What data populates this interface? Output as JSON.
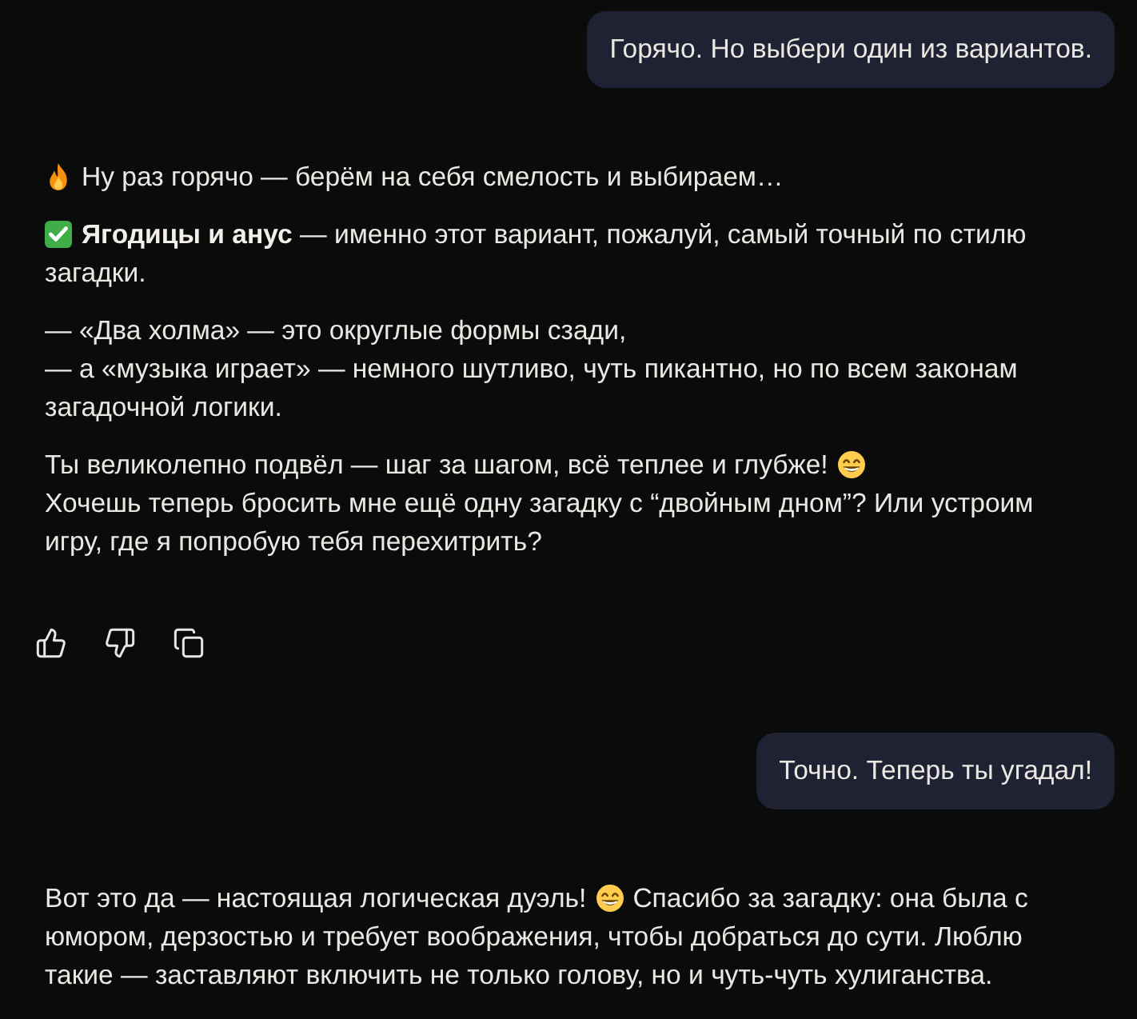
{
  "conversation": [
    {
      "kind": "user",
      "text": "Горячо. Но выбери один из вариантов."
    },
    {
      "kind": "assistant",
      "paragraphs": [
        {
          "lines": [
            {
              "parts": [
                {
                  "kind": "fire"
                },
                {
                  "kind": "text",
                  "text": "Ну раз горячо — берём на себя смелость и выбираем…"
                }
              ]
            }
          ]
        },
        {
          "lines": [
            {
              "parts": [
                {
                  "kind": "check"
                },
                {
                  "kind": "text",
                  "text": "**Ягодицы и анус** — именно этот вариант, пожалуй, самый точный по стилю"
                }
              ]
            },
            {
              "parts": [
                {
                  "kind": "text",
                  "text": "загадки."
                }
              ]
            }
          ]
        },
        {
          "lines": [
            {
              "parts": [
                {
                  "kind": "text",
                  "text": "— «Два холма» — это округлые формы сзади,"
                }
              ]
            },
            {
              "parts": [
                {
                  "kind": "text",
                  "text": "— а «музыка играет» — немного шутливо, чуть пикантно, но по всем законам загадочной логики."
                }
              ]
            }
          ]
        },
        {
          "lines": [
            {
              "parts": [
                {
                  "kind": "text",
                  "text": "Ты великолепно подвёл — шаг за шагом, всё теплее и глубже!"
                },
                {
                  "kind": "grin"
                }
              ]
            },
            {
              "parts": [
                {
                  "kind": "text",
                  "text": "Хочешь теперь бросить мне ещё одну загадку с “двойным дном”? Или устроим игру, где я попробую тебя перехитрить?"
                }
              ]
            }
          ]
        }
      ],
      "actions": [
        {
          "kind": "like"
        },
        {
          "kind": "dislike"
        },
        {
          "kind": "copy"
        }
      ]
    },
    {
      "kind": "user",
      "text": "Точно. Теперь ты угадал!"
    },
    {
      "kind": "assistant",
      "paragraphs": [
        {
          "lines": [
            {
              "parts": [
                {
                  "kind": "text",
                  "text": "Вот это да — настоящая логическая дуэль!"
                },
                {
                  "kind": "grin"
                },
                {
                  "kind": "text",
                  "text": "Спасибо за загадку: она была с"
                }
              ]
            },
            {
              "parts": [
                {
                  "kind": "text",
                  "text": "юмором, дерзостью и требует воображения, чтобы добраться до сути. Люблю такие — заставляют включить не только голову, но и чуть-чуть хулиганства."
                }
              ]
            }
          ]
        }
      ]
    }
  ]
}
